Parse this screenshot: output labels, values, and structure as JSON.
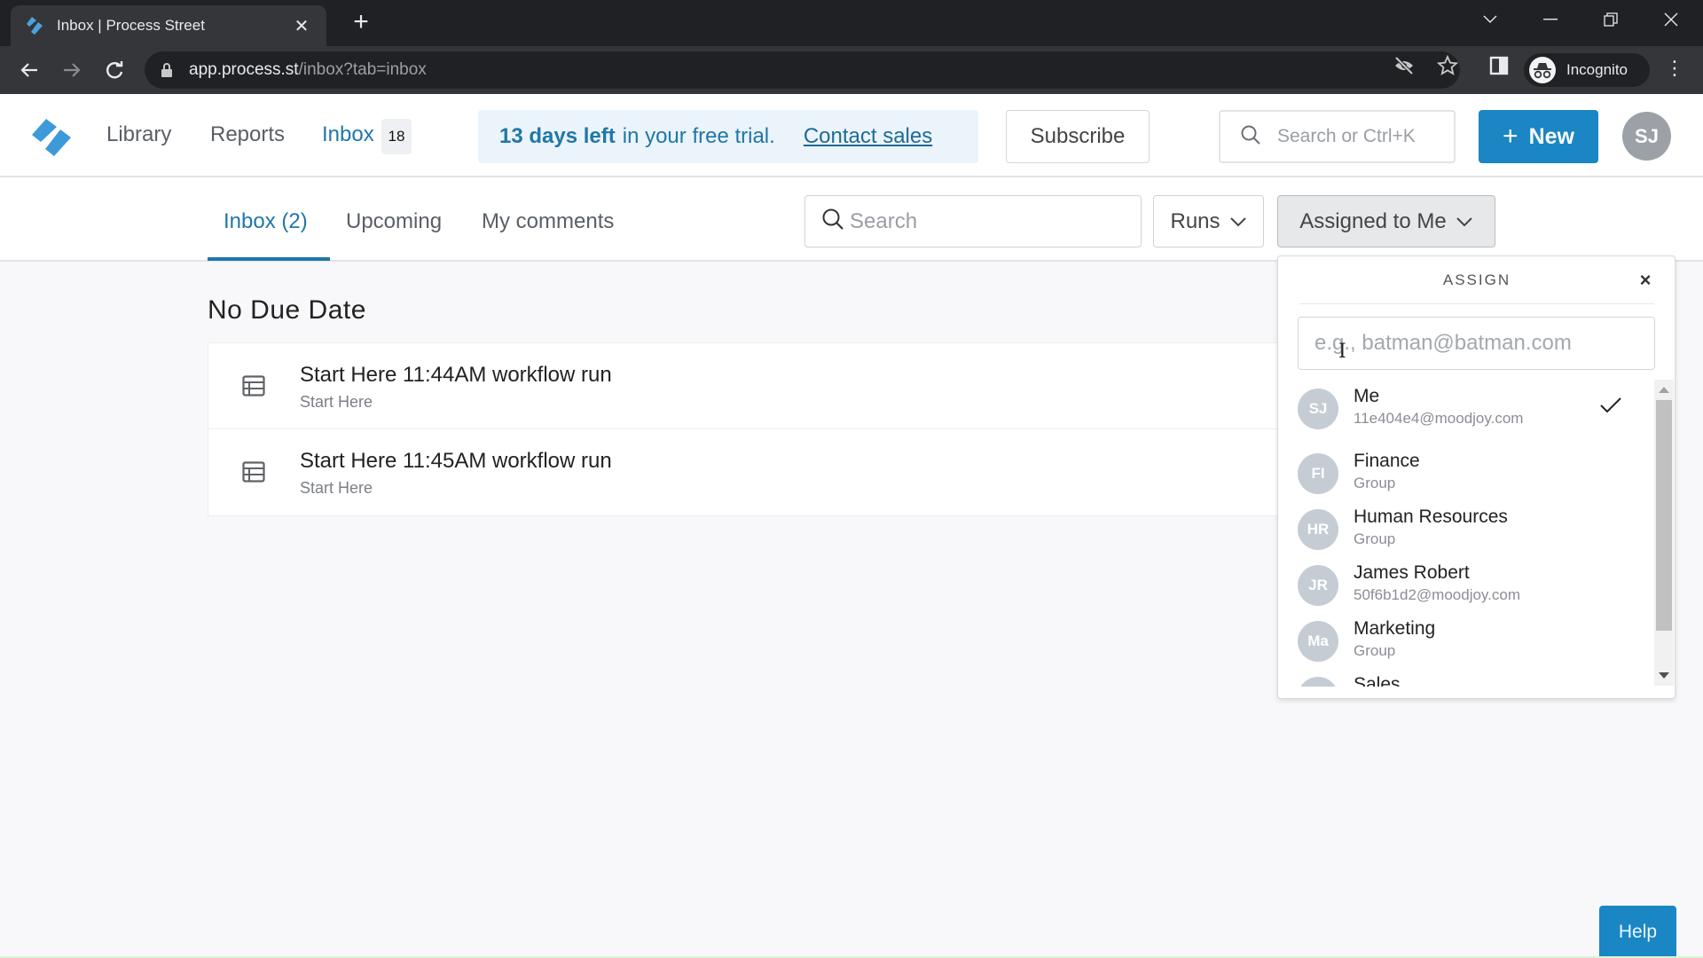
{
  "browser": {
    "tab_title": "Inbox | Process Street",
    "url_host": "app.process.st",
    "url_path": "/inbox?tab=inbox",
    "profile_label": "Incognito"
  },
  "header": {
    "nav": [
      {
        "label": "Library",
        "active": false
      },
      {
        "label": "Reports",
        "active": false
      },
      {
        "label": "Inbox",
        "active": true
      }
    ],
    "inbox_badge": "18",
    "trial": {
      "days_left": "13 days left",
      "rest": "in your free trial.",
      "contact_sales": "Contact sales"
    },
    "subscribe_label": "Subscribe",
    "search_placeholder": "Search or Ctrl+K",
    "new_label": "New",
    "avatar_initials": "SJ",
    "brand_color": "#1a86c3"
  },
  "subnav": {
    "tabs": [
      {
        "label": "Inbox (2)",
        "active": true
      },
      {
        "label": "Upcoming",
        "active": false
      },
      {
        "label": "My comments",
        "active": false
      }
    ],
    "search_placeholder": "Search",
    "runs_label": "Runs",
    "assigned_label": "Assigned to Me"
  },
  "content": {
    "section_title": "No Due Date",
    "items": [
      {
        "title": "Start Here 11:44AM workflow run",
        "subtitle": "Start Here"
      },
      {
        "title": "Start Here 11:45AM workflow run",
        "subtitle": "Start Here"
      }
    ]
  },
  "assign_dropdown": {
    "title": "ASSIGN",
    "input_placeholder": "e.g., batman@batman.com",
    "options": [
      {
        "initials": "SJ",
        "name": "Me",
        "sub": "11e404e4@moodjoy.com",
        "selected": true
      },
      {
        "initials": "FI",
        "name": "Finance",
        "sub": "Group",
        "selected": false
      },
      {
        "initials": "HR",
        "name": "Human Resources",
        "sub": "Group",
        "selected": false
      },
      {
        "initials": "JR",
        "name": "James Robert",
        "sub": "50f6b1d2@moodjoy.com",
        "selected": false
      },
      {
        "initials": "Ma",
        "name": "Marketing",
        "sub": "Group",
        "selected": false
      },
      {
        "initials": "",
        "name": "Sales",
        "sub": "",
        "selected": false
      }
    ]
  },
  "help_label": "Help"
}
